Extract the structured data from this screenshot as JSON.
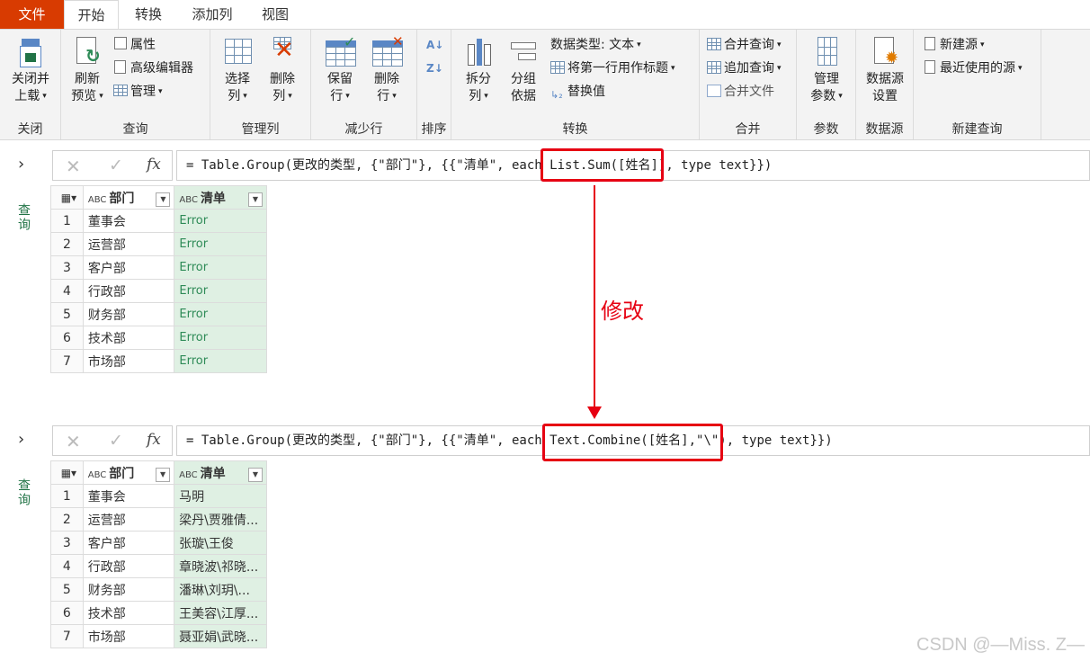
{
  "tabs": {
    "file": "文件",
    "home": "开始",
    "transform": "转换",
    "add_column": "添加列",
    "view": "视图"
  },
  "ribbon": {
    "close": {
      "btn_line1": "关闭并",
      "btn_line2": "上载",
      "group": "关闭"
    },
    "query": {
      "refresh_line1": "刷新",
      "refresh_line2": "预览",
      "properties": "属性",
      "advanced_editor": "高级编辑器",
      "manage": "管理",
      "group": "查询"
    },
    "manage_columns": {
      "choose_line1": "选择",
      "choose_line2": "列",
      "remove_line1": "删除",
      "remove_line2": "列",
      "group": "管理列"
    },
    "reduce_rows": {
      "keep_line1": "保留",
      "keep_line2": "行",
      "remove_line1": "删除",
      "remove_line2": "行",
      "group": "减少行"
    },
    "sort": {
      "group": "排序"
    },
    "transform": {
      "split_line1": "拆分",
      "split_line2": "列",
      "group_line1": "分组",
      "group_line2": "依据",
      "data_type": "数据类型: 文本",
      "first_row_header": "将第一行用作标题",
      "replace_values": "替换值",
      "group": "转换"
    },
    "combine": {
      "merge_queries": "合并查询",
      "append_queries": "追加查询",
      "combine_files": "合并文件",
      "group": "合并"
    },
    "parameters": {
      "manage_line1": "管理",
      "manage_line2": "参数",
      "group": "参数"
    },
    "data_source": {
      "btn_line1": "数据源",
      "btn_line2": "设置",
      "group": "数据源"
    },
    "new_query": {
      "new_source": "新建源",
      "recent_sources": "最近使用的源",
      "group": "新建查询"
    }
  },
  "side": {
    "chevron": "›",
    "label": "查询"
  },
  "formula_bar": {
    "cancel": "✕",
    "commit": "✓",
    "fx": "fx"
  },
  "panel1": {
    "formula_prefix": "= Table.Group(更改的类型, {\"部门\"}, {{\"清单\", each ",
    "formula_highlight": "List.Sum([姓名])",
    "formula_suffix": ", type text}})",
    "columns": [
      "部门",
      "清单"
    ],
    "rows": [
      {
        "n": "1",
        "dept": "董事会",
        "list": "Error"
      },
      {
        "n": "2",
        "dept": "运营部",
        "list": "Error"
      },
      {
        "n": "3",
        "dept": "客户部",
        "list": "Error"
      },
      {
        "n": "4",
        "dept": "行政部",
        "list": "Error"
      },
      {
        "n": "5",
        "dept": "财务部",
        "list": "Error"
      },
      {
        "n": "6",
        "dept": "技术部",
        "list": "Error"
      },
      {
        "n": "7",
        "dept": "市场部",
        "list": "Error"
      }
    ]
  },
  "panel2": {
    "formula_prefix": "= Table.Group(更改的类型, {\"部门\"}, {{\"清单\", each ",
    "formula_highlight": "Text.Combine([姓名],\"\\\")",
    "formula_suffix": ", type text}})",
    "columns": [
      "部门",
      "清单"
    ],
    "rows": [
      {
        "n": "1",
        "dept": "董事会",
        "list": "马明"
      },
      {
        "n": "2",
        "dept": "运营部",
        "list": "梁丹\\贾雅倩..."
      },
      {
        "n": "3",
        "dept": "客户部",
        "list": "张璇\\王俊"
      },
      {
        "n": "4",
        "dept": "行政部",
        "list": "章晓波\\祁晓..."
      },
      {
        "n": "5",
        "dept": "财务部",
        "list": "潘琳\\刘玥\\..."
      },
      {
        "n": "6",
        "dept": "技术部",
        "list": "王美容\\江厚..."
      },
      {
        "n": "7",
        "dept": "市场部",
        "list": "聂亚娟\\武晓..."
      }
    ]
  },
  "annotation": "修改",
  "watermark": "CSDN @—Miss. Z—",
  "colors": {
    "file_tab": "#d83b01",
    "highlight_box": "#e60012",
    "selected_column": "#dff0e3",
    "error_text": "#2e8b57"
  }
}
